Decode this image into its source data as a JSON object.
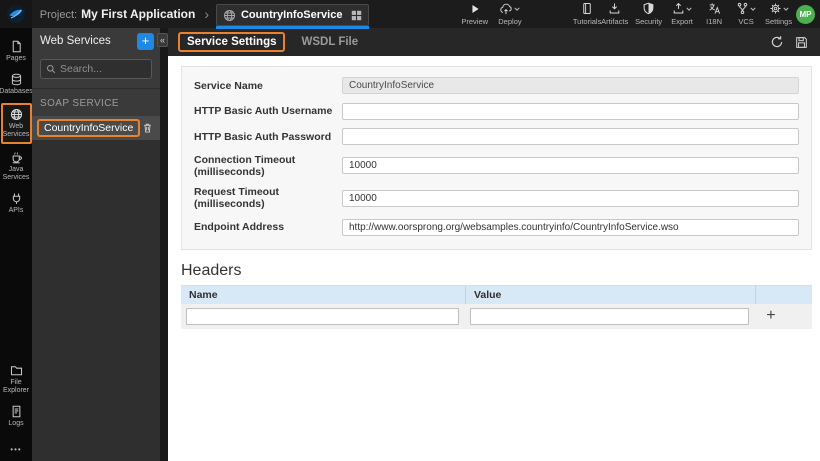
{
  "topbar": {
    "project_label": "Project:",
    "project_name": "My First Application",
    "breadcrumb_chevron": "›",
    "service_tab": "CountryInfoService",
    "preview": "Preview",
    "deploy": "Deploy",
    "tutorials": "Tutorials",
    "artifacts": "Artifacts",
    "security": "Security",
    "export": "Export",
    "i18n": "I18N",
    "vcs": "VCS",
    "settings": "Settings",
    "avatar_initials": "MP"
  },
  "left_rail": {
    "pages": "Pages",
    "databases": "Databases",
    "web_services": "Web Services",
    "java_services": "Java Services",
    "apis": "APIs",
    "file_explorer": "File Explorer",
    "logs": "Logs",
    "more": "•••"
  },
  "sidebar": {
    "title": "Web Services",
    "add_label": "+",
    "collapse_label": "«",
    "search_placeholder": "Search...",
    "section_label": "SOAP SERVICE",
    "service_name": "CountryInfoService"
  },
  "main": {
    "tab_service_settings": "Service Settings",
    "tab_wsdl_file": "WSDL File",
    "form": {
      "rows": [
        {
          "label": "Service Name",
          "value": "CountryInfoService"
        },
        {
          "label": "HTTP Basic Auth Username",
          "value": ""
        },
        {
          "label": "HTTP Basic Auth Password",
          "value": ""
        },
        {
          "label": "Connection Timeout (milliseconds)",
          "value": "10000"
        },
        {
          "label": "Request Timeout (milliseconds)",
          "value": "10000"
        },
        {
          "label": "Endpoint Address",
          "value": "http://www.oorsprong.org/websamples.countryinfo/CountryInfoService.wso"
        }
      ]
    },
    "headers": {
      "title": "Headers",
      "col_name": "Name",
      "col_value": "Value",
      "add_label": "+"
    }
  },
  "colors": {
    "accent_orange": "#e8822d",
    "accent_blue": "#1e88e5",
    "avatar_green": "#4caf50",
    "table_header_bg": "#d7e8f6"
  }
}
